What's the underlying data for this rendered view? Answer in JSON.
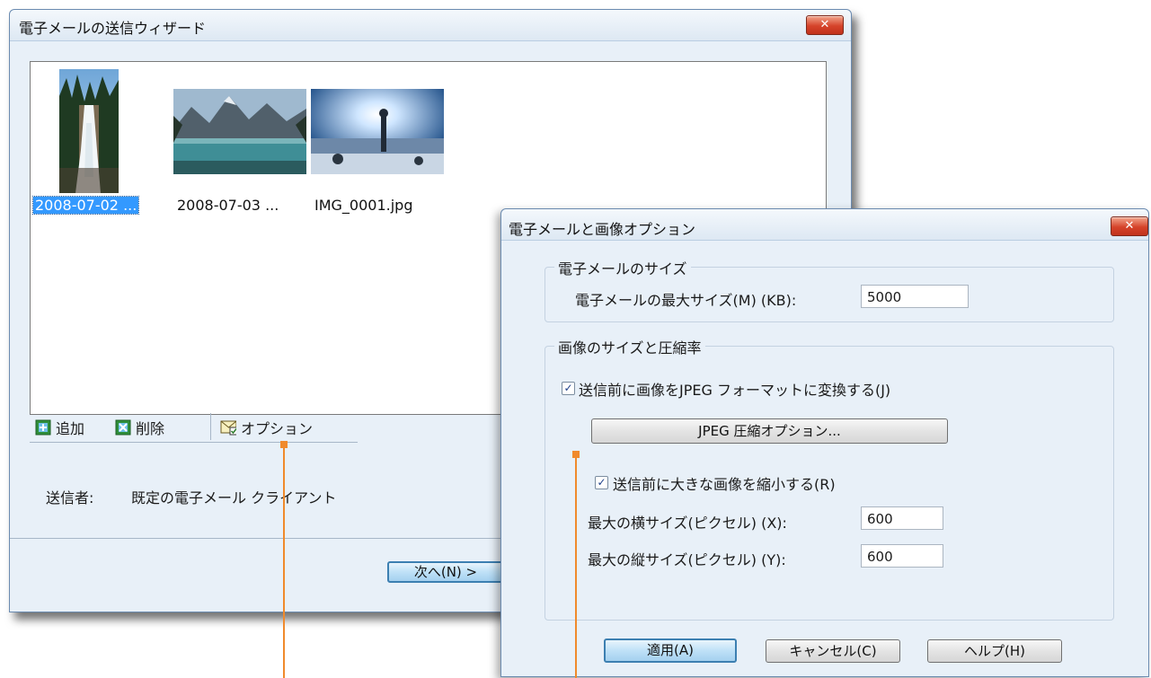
{
  "wizard": {
    "title": "電子メールの送信ウィザード",
    "close_label": "✕",
    "thumbnails": [
      {
        "label": "2008-07-02 ...",
        "selected": true
      },
      {
        "label": "2008-07-03 ...",
        "selected": false
      },
      {
        "label": "IMG_0001.jpg",
        "selected": false
      }
    ],
    "toolbar": {
      "add_label": "追加",
      "delete_label": "削除",
      "options_label": "オプション"
    },
    "sender_label": "送信者:",
    "sender_value": "既定の電子メール クライアント",
    "next_label": "次へ(N) >"
  },
  "options": {
    "title": "電子メールと画像オプション",
    "close_label": "✕",
    "email_size_group": {
      "title": "電子メールのサイズ",
      "max_size_label": "電子メールの最大サイズ(M) (KB):",
      "max_size_value": "5000"
    },
    "image_group": {
      "title": "画像のサイズと圧縮率",
      "convert_jpeg_label": "送信前に画像をJPEG フォーマットに変換する(J)",
      "convert_jpeg_checked": true,
      "jpeg_options_button": "JPEG 圧縮オプション...",
      "shrink_label": "送信前に大きな画像を縮小する(R)",
      "shrink_checked": true,
      "max_width_label": "最大の横サイズ(ピクセル) (X):",
      "max_width_value": "600",
      "max_height_label": "最大の縦サイズ(ピクセル) (Y):",
      "max_height_value": "600"
    },
    "buttons": {
      "apply": "適用(A)",
      "cancel": "キャンセル(C)",
      "help": "ヘルプ(H)"
    }
  },
  "colors": {
    "callout": "#f08a2c",
    "selection": "#3399ff",
    "window_bg": "#e8f0f8"
  }
}
